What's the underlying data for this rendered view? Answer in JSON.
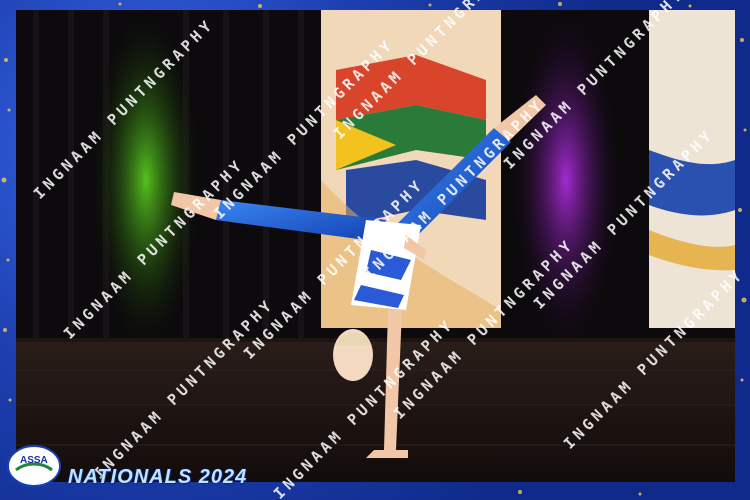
{
  "event": {
    "badge_text": "ASSA",
    "title": "NATIONALS 2024"
  },
  "watermark": {
    "text": "INGNAAM PUNTNGRAPHY"
  },
  "colors": {
    "frame_blue": "#1a3fb8",
    "leotard_blue": "#1f5fd6",
    "curtain_green": "#33a019",
    "curtain_purple": "#7a1aa0"
  }
}
